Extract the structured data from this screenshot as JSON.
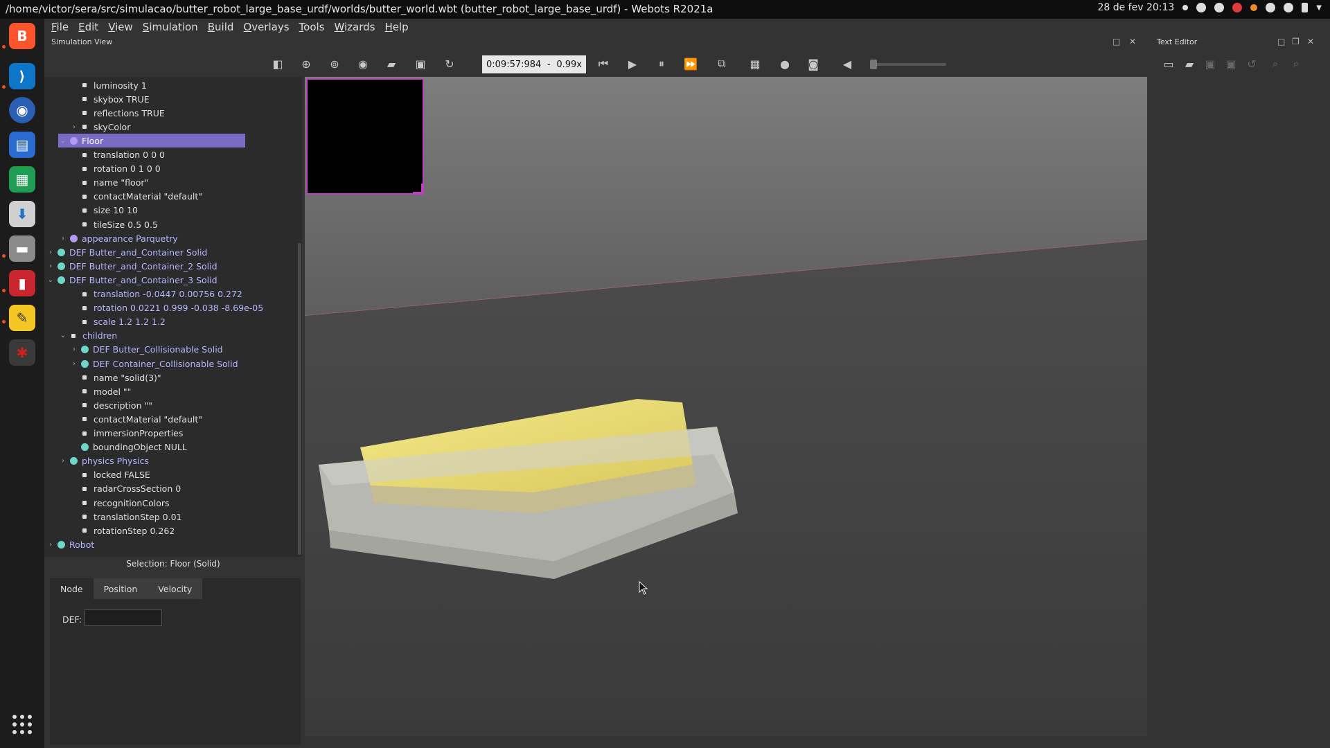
{
  "window_title": "/home/victor/sera/src/simulacao/butter_robot_large_base_urdf/worlds/butter_world.wbt (butter_robot_large_base_urdf) - Webots R2021a",
  "clock": "28 de fev  20:13",
  "menu": [
    "File",
    "Edit",
    "View",
    "Simulation",
    "Build",
    "Overlays",
    "Tools",
    "Wizards",
    "Help"
  ],
  "panes": {
    "simulation_view": "Simulation View",
    "text_editor": "Text Editor"
  },
  "toolbar": {
    "time": "0:09:57:984",
    "separator": "-",
    "speed": "0.99x"
  },
  "scene_tree": [
    {
      "text": "luminosity 1",
      "kind": "field",
      "level": 2
    },
    {
      "text": "skybox TRUE",
      "kind": "field",
      "level": 2
    },
    {
      "text": "reflections TRUE",
      "kind": "field",
      "level": 2
    },
    {
      "text": "skyColor",
      "kind": "field",
      "level": 2,
      "arrow": "›"
    },
    {
      "text": "Floor",
      "kind": "node",
      "level": 0,
      "arrow": "⌄",
      "dot": "purple",
      "selected": true
    },
    {
      "text": "translation 0 0 0",
      "kind": "field",
      "level": 2
    },
    {
      "text": "rotation 0 1 0 0",
      "kind": "field",
      "level": 2
    },
    {
      "text": "name \"floor\"",
      "kind": "field",
      "level": 2
    },
    {
      "text": "contactMaterial \"default\"",
      "kind": "field",
      "level": 2
    },
    {
      "text": "size 10 10",
      "kind": "field",
      "level": 2
    },
    {
      "text": "tileSize 0.5 0.5",
      "kind": "field",
      "level": 2
    },
    {
      "text": "appearance Parquetry",
      "kind": "node",
      "level": 1,
      "arrow": "›",
      "dot": "purple"
    },
    {
      "text": "DEF Butter_and_Container Solid",
      "kind": "node",
      "level": 0,
      "arrow": "›",
      "dot": "teal"
    },
    {
      "text": "DEF Butter_and_Container_2 Solid",
      "kind": "node",
      "level": 0,
      "arrow": "›",
      "dot": "teal"
    },
    {
      "text": "DEF Butter_and_Container_3 Solid",
      "kind": "node",
      "level": 0,
      "arrow": "⌄",
      "dot": "teal"
    },
    {
      "text": "translation -0.0447 0.00756 0.272",
      "kind": "node",
      "level": 2,
      "bullet": true
    },
    {
      "text": "rotation 0.0221 0.999 -0.038 -8.69e-05",
      "kind": "node",
      "level": 2,
      "bullet": true
    },
    {
      "text": "scale 1.2 1.2 1.2",
      "kind": "node",
      "level": 2,
      "bullet": true
    },
    {
      "text": "children",
      "kind": "node",
      "level": 1,
      "arrow": "⌄",
      "bullet": true
    },
    {
      "text": "DEF Butter_Collisionable Solid",
      "kind": "node",
      "level": 2,
      "arrow": "›",
      "dot": "teal"
    },
    {
      "text": "DEF Container_Collisionable Solid",
      "kind": "node",
      "level": 2,
      "arrow": "›",
      "dot": "teal"
    },
    {
      "text": "name \"solid(3)\"",
      "kind": "field",
      "level": 2
    },
    {
      "text": "model \"\"",
      "kind": "field",
      "level": 2
    },
    {
      "text": "description \"\"",
      "kind": "field",
      "level": 2
    },
    {
      "text": "contactMaterial \"default\"",
      "kind": "field",
      "level": 2
    },
    {
      "text": "immersionProperties",
      "kind": "field",
      "level": 2
    },
    {
      "text": "boundingObject NULL",
      "kind": "field",
      "level": 2,
      "dot": "teal"
    },
    {
      "text": "physics Physics",
      "kind": "node",
      "level": 1,
      "arrow": "›",
      "dot": "teal"
    },
    {
      "text": "locked FALSE",
      "kind": "field",
      "level": 2
    },
    {
      "text": "radarCrossSection 0",
      "kind": "field",
      "level": 2
    },
    {
      "text": "recognitionColors",
      "kind": "field",
      "level": 2
    },
    {
      "text": "translationStep 0.01",
      "kind": "field",
      "level": 2
    },
    {
      "text": "rotationStep 0.262",
      "kind": "field",
      "level": 2
    },
    {
      "text": "Robot",
      "kind": "node",
      "level": 0,
      "arrow": "›",
      "dot": "teal"
    }
  ],
  "selection": "Selection: Floor (Solid)",
  "field_editor": {
    "tabs": [
      "Node",
      "Position",
      "Velocity"
    ],
    "active_tab": "Node",
    "def_label": "DEF:",
    "def_value": ""
  },
  "colors": {
    "selected": "#7a6bc4",
    "node_text": "#b6b6ff",
    "camera_border": "#c040c0"
  }
}
